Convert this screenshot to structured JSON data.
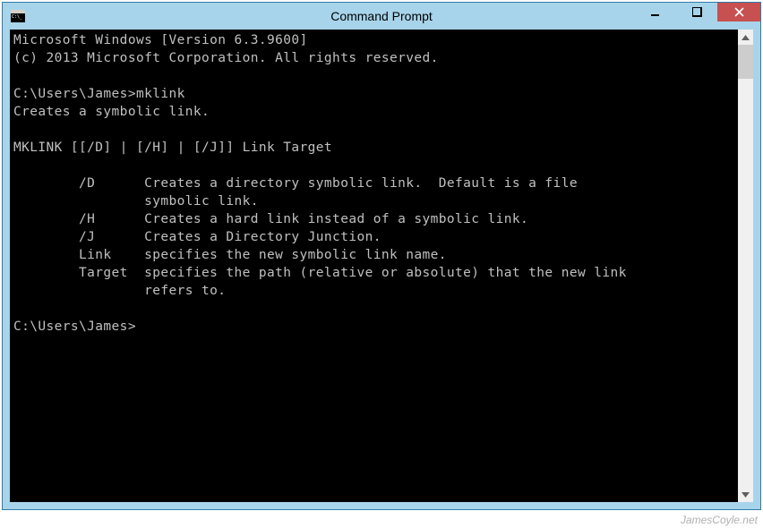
{
  "window": {
    "title": "Command Prompt"
  },
  "console": {
    "lines": [
      "Microsoft Windows [Version 6.3.9600]",
      "(c) 2013 Microsoft Corporation. All rights reserved.",
      "",
      "C:\\Users\\James>mklink",
      "Creates a symbolic link.",
      "",
      "MKLINK [[/D] | [/H] | [/J]] Link Target",
      "",
      "        /D      Creates a directory symbolic link.  Default is a file",
      "                symbolic link.",
      "        /H      Creates a hard link instead of a symbolic link.",
      "        /J      Creates a Directory Junction.",
      "        Link    specifies the new symbolic link name.",
      "        Target  specifies the path (relative or absolute) that the new link",
      "                refers to.",
      "",
      "C:\\Users\\James>"
    ]
  },
  "watermark": "JamesCoyle.net"
}
